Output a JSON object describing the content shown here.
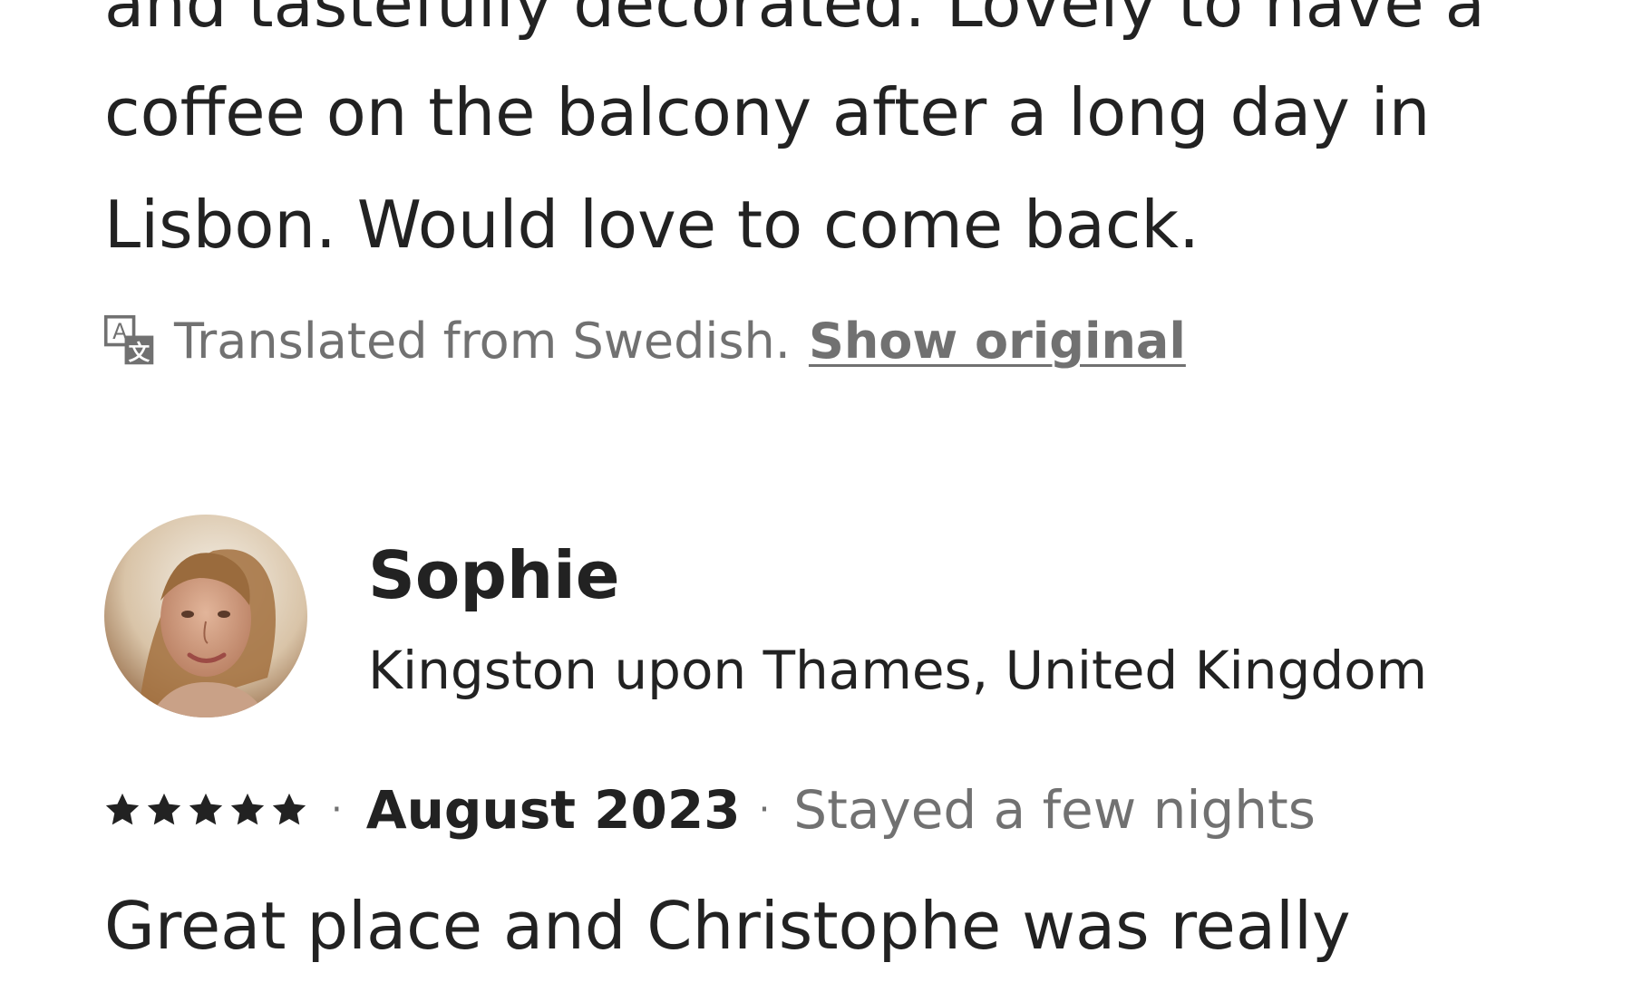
{
  "previous_review": {
    "lines": [
      "and tastefully decorated. Lovely to have a",
      "coffee on the balcony after a long day in",
      "Lisbon. Would love to come back."
    ],
    "translation_note": "Translated from Swedish.",
    "show_original_label": "Show original",
    "translate_icon": "translate-icon"
  },
  "review": {
    "reviewer_name": "Sophie",
    "reviewer_location": "Kingston upon Thames, United Kingdom",
    "rating_stars": 5,
    "date": "August 2023",
    "stay_length": "Stayed a few nights",
    "text_start": "Great place and Christophe was really"
  },
  "colors": {
    "text_primary": "#222222",
    "text_secondary": "#717171"
  }
}
